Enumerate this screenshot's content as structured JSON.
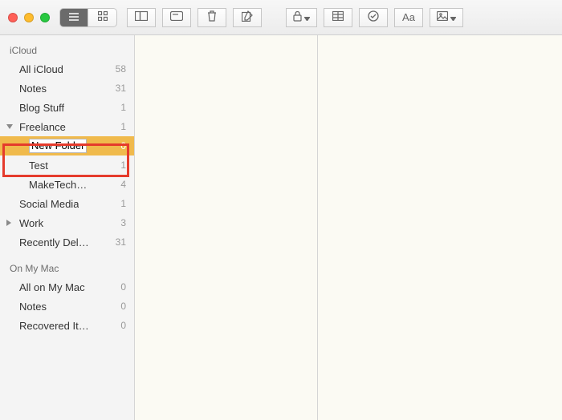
{
  "toolbar": {
    "list_view": "list",
    "grid_view": "grid",
    "attachments": "attachments",
    "checklist_alt": "checklist",
    "trash": "trash",
    "compose": "compose",
    "lock": "lock",
    "table": "table",
    "checklist": "checklist",
    "format": "Aa",
    "media": "media"
  },
  "sections": {
    "icloud": {
      "header": "iCloud"
    },
    "onmymac": {
      "header": "On My Mac"
    }
  },
  "sidebar": {
    "items": [
      {
        "label": "All iCloud",
        "count": "58"
      },
      {
        "label": "Notes",
        "count": "31"
      },
      {
        "label": "Blog Stuff",
        "count": "1"
      },
      {
        "label": "Freelance",
        "count": "1"
      },
      {
        "label": "New Folder",
        "count": "0"
      },
      {
        "label": "Test",
        "count": "1"
      },
      {
        "label": "MakeTech…",
        "count": "4"
      },
      {
        "label": "Social Media",
        "count": "1"
      },
      {
        "label": "Work",
        "count": "3"
      },
      {
        "label": "Recently Del…",
        "count": "31"
      },
      {
        "label": "All on My Mac",
        "count": "0"
      },
      {
        "label": "Notes",
        "count": "0"
      },
      {
        "label": "Recovered It…",
        "count": "0"
      }
    ]
  },
  "colors": {
    "highlight": "#e53b2c",
    "selection": "#f0ba4c"
  }
}
